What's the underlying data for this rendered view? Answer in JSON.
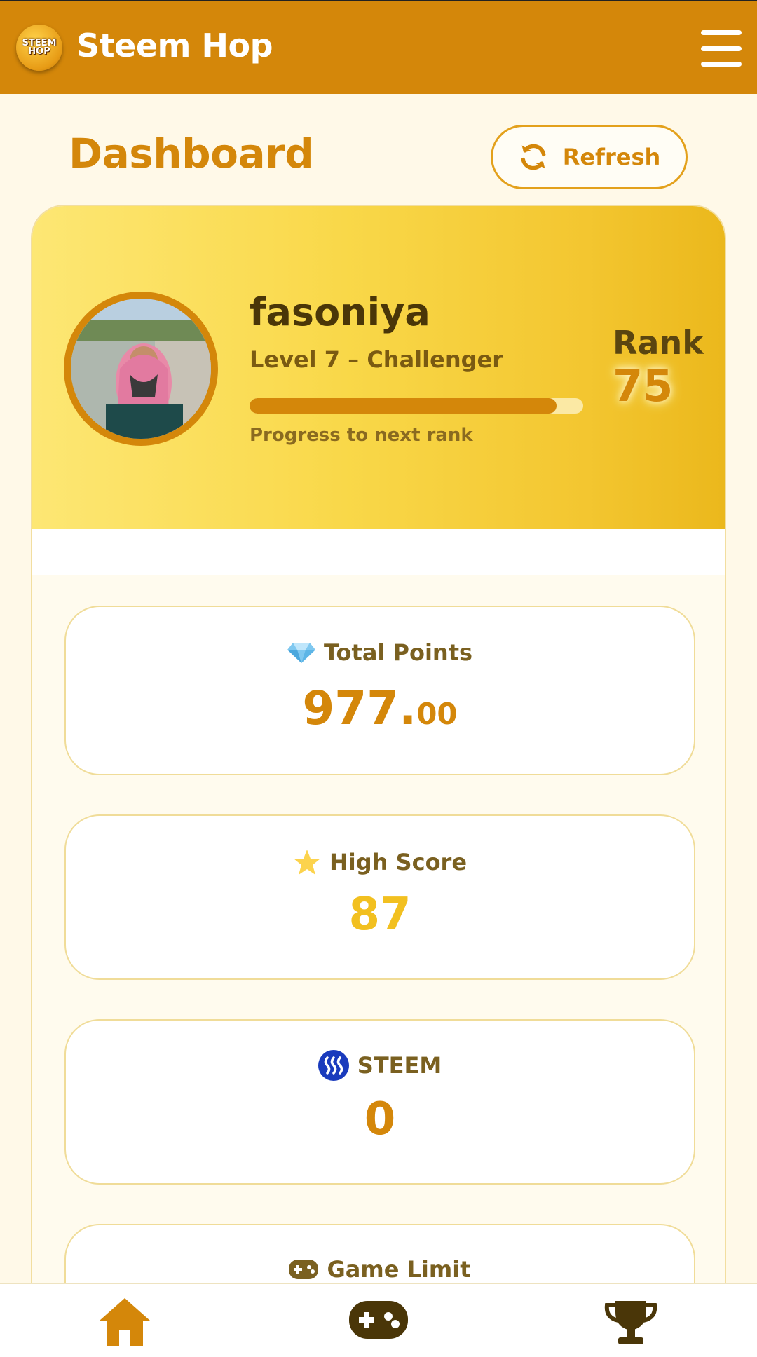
{
  "header": {
    "app_name": "Steem Hop",
    "logo_text_line1": "STEEM",
    "logo_text_line2": "HOP"
  },
  "page": {
    "title": "Dashboard",
    "refresh_label": "Refresh"
  },
  "profile": {
    "username": "fasoniya",
    "level": "Level 7 – Challenger",
    "progress_label": "Progress to next rank",
    "progress_fraction": 0.92,
    "rank_label": "Rank",
    "rank_value": "75"
  },
  "stats": {
    "total_points": {
      "label": "Total Points",
      "value_main": "977.",
      "value_decimal": "00",
      "icon": "diamond-icon"
    },
    "high_score": {
      "label": "High Score",
      "value": "87",
      "icon": "star-icon"
    },
    "steem": {
      "label": "STEEM",
      "value": "0",
      "icon": "steem-icon"
    },
    "game_limit": {
      "label": "Game Limit",
      "icon": "gamepad-icon"
    }
  },
  "bottom_nav": {
    "items": [
      "home-icon",
      "gamepad-icon",
      "trophy-icon"
    ]
  },
  "colors": {
    "brand": "#d4870a",
    "background": "#fff9e8",
    "profile_gradient_start": "#fde774",
    "profile_gradient_end": "#ebb81c",
    "high_score_color": "#f2c020",
    "steem_blue": "#1a3bbd"
  }
}
